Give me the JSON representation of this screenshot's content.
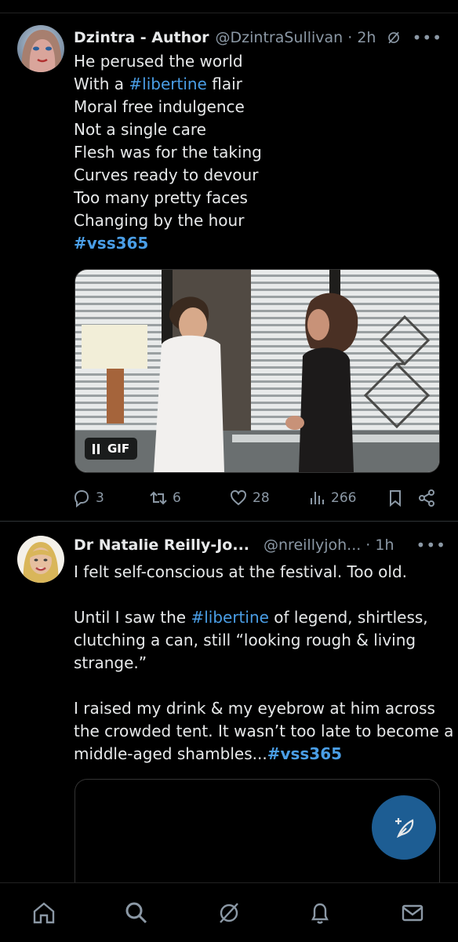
{
  "tweets": [
    {
      "author": "Dzintra - Author",
      "handle": "@DzintraSullivan",
      "time": "· 2h",
      "lines": [
        {
          "before": "He perused the world",
          "tag": "",
          "after": ""
        },
        {
          "before": "With a ",
          "tag": "#libertine",
          "after": " flair"
        },
        {
          "before": "Moral free indulgence",
          "tag": "",
          "after": ""
        },
        {
          "before": "Not a single care",
          "tag": "",
          "after": ""
        },
        {
          "before": "Flesh was for the taking",
          "tag": "",
          "after": ""
        },
        {
          "before": "Curves ready to devour",
          "tag": "",
          "after": ""
        },
        {
          "before": "Too many pretty faces",
          "tag": "",
          "after": ""
        },
        {
          "before": "Changing by the hour",
          "tag": "",
          "after": ""
        }
      ],
      "closing_tag": "#vss365",
      "media_badge": "GIF",
      "replies": "3",
      "reposts": "6",
      "likes": "28",
      "views": "266"
    },
    {
      "author": "Dr Natalie Reilly-Jo...",
      "handle": "@nreillyjoh...",
      "time": "· 1h",
      "p1": "I felt self-conscious at the festival. Too old.",
      "p2_l1_before": "Until I saw the ",
      "p2_l1_tag": "#libertine",
      "p2_l1_after": " of legend, shirtless,",
      "p2_l2": "clutching a can, still “looking rough & living",
      "p2_l3": "strange.”",
      "p3_l1": "I raised my drink & my eyebrow at him across",
      "p3_l2": "the crowded tent. It wasn’t too late to become a",
      "p3_l3": "middle-aged shambles...",
      "p3_tag": "#vss365"
    }
  ],
  "icons": {
    "reply": "reply-icon",
    "repost": "repost-icon",
    "like": "heart-icon",
    "views": "views-icon",
    "bookmark": "bookmark-icon",
    "share": "share-icon",
    "grok": "grok-icon",
    "compose": "compose-icon",
    "nav": [
      "home-icon",
      "search-icon",
      "grok-icon",
      "notifications-icon",
      "messages-icon"
    ]
  },
  "colors": {
    "background": "#000000",
    "text": "#e7e9ea",
    "muted": "#8b98a5",
    "accent": "#4a9ee6",
    "fab": "#1d5d93"
  }
}
